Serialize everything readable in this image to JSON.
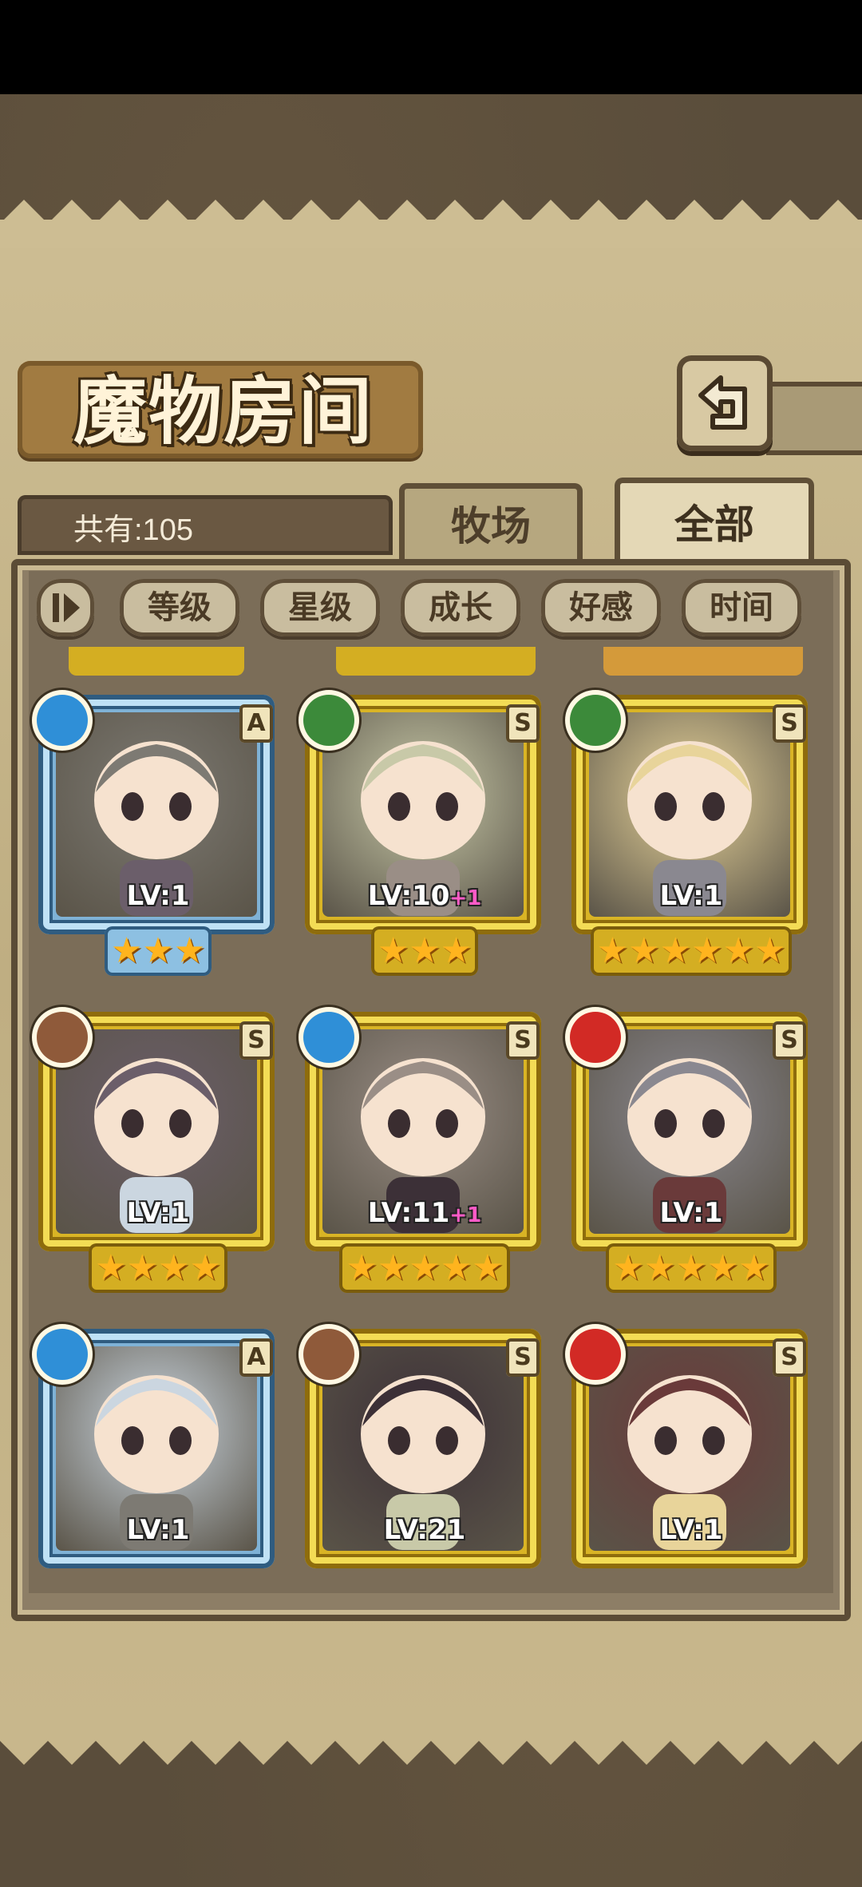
{
  "header": {
    "title": "魔物房间"
  },
  "summary": {
    "count_label": "共有:105"
  },
  "tabs": [
    {
      "label": "牧场",
      "active": false
    },
    {
      "label": "全部",
      "active": true
    }
  ],
  "filters": [
    "等级",
    "星级",
    "成长",
    "好感",
    "时间"
  ],
  "cards": [
    {
      "element": "water",
      "rank": "A",
      "frame": "blue",
      "level": "LV:1",
      "plus": "",
      "stars": 3
    },
    {
      "element": "leaf",
      "rank": "S",
      "frame": "gold",
      "level": "LV:10",
      "plus": "+1",
      "stars": 3
    },
    {
      "element": "leaf",
      "rank": "S",
      "frame": "gold",
      "level": "LV:1",
      "plus": "",
      "stars": 6
    },
    {
      "element": "earth",
      "rank": "S",
      "frame": "gold",
      "level": "LV:1",
      "plus": "",
      "stars": 4
    },
    {
      "element": "water",
      "rank": "S",
      "frame": "gold",
      "level": "LV:11",
      "plus": "+1",
      "stars": 5
    },
    {
      "element": "fire",
      "rank": "S",
      "frame": "gold",
      "level": "LV:1",
      "plus": "",
      "stars": 5
    },
    {
      "element": "water",
      "rank": "A",
      "frame": "blue",
      "level": "LV:1",
      "plus": "",
      "stars": 0
    },
    {
      "element": "earth",
      "rank": "S",
      "frame": "gold",
      "level": "LV:21",
      "plus": "",
      "stars": 0
    },
    {
      "element": "fire",
      "rank": "S",
      "frame": "gold",
      "level": "LV:1",
      "plus": "",
      "stars": 0
    }
  ],
  "colors": {
    "gold_frame": "#d9b425",
    "blue_frame": "#7fb2d6",
    "water": "#2f8fd7",
    "leaf": "#3c8a3a",
    "earth": "#8f5a3a",
    "fire": "#d22a25",
    "plus_text": "#ff5bc7"
  }
}
